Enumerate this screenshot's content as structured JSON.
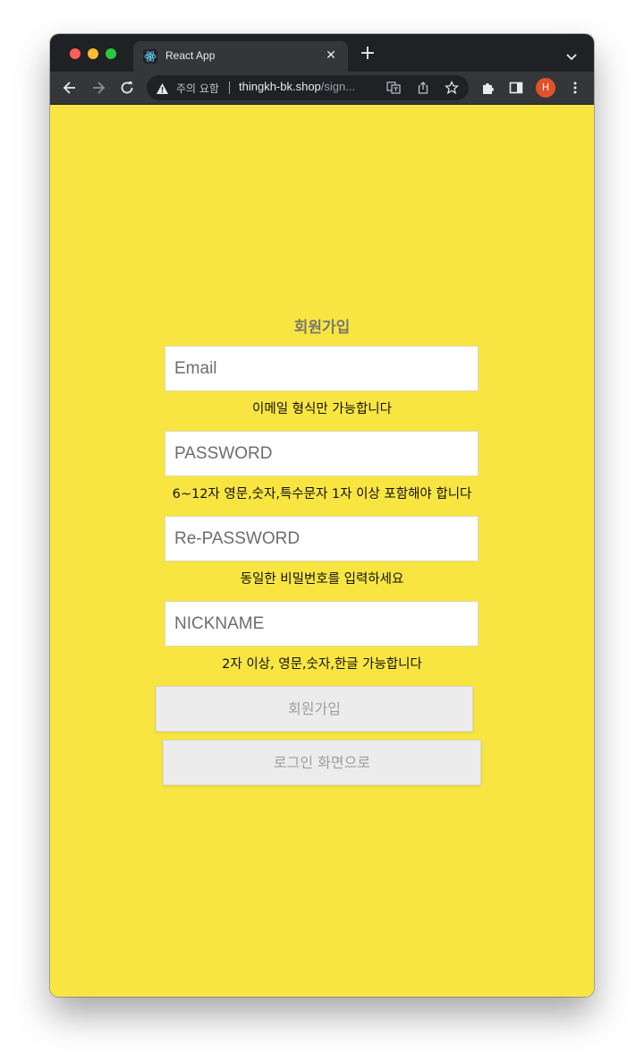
{
  "browser": {
    "tab_title": "React App",
    "security_label": "주의 요함",
    "url_domain": "thingkh-bk.shop",
    "url_path": "/sign...",
    "profile_initial": "H",
    "accent_colors": {
      "red": "#ff5f57",
      "yellow": "#febc2e",
      "green": "#28c840",
      "avatar": "#e2512a"
    }
  },
  "page": {
    "background": "#f9e542",
    "title": "회원가입",
    "fields": {
      "email": {
        "placeholder": "Email",
        "value": "",
        "hint": "이메일 형식만 가능합니다"
      },
      "password": {
        "placeholder": "PASSWORD",
        "value": "",
        "hint": "6~12자 영문,숫자,특수문자 1자 이상 포함해야 합니다"
      },
      "repassword": {
        "placeholder": "Re-PASSWORD",
        "value": "",
        "hint": "동일한 비밀번호를 입력하세요"
      },
      "nickname": {
        "placeholder": "NICKNAME",
        "value": "",
        "hint": "2자 이상, 영문,숫자,한글 가능합니다"
      }
    },
    "buttons": {
      "signup": "회원가입",
      "to_login": "로그인 화면으로"
    }
  }
}
